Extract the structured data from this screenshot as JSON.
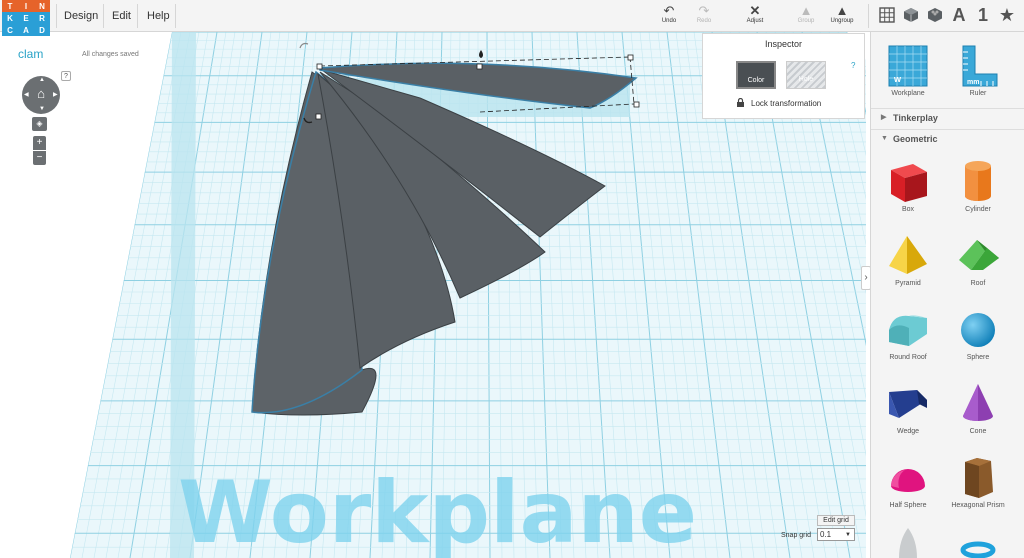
{
  "logo": {
    "letters": [
      "T",
      "I",
      "N",
      "K",
      "E",
      "R",
      "C",
      "A",
      "D"
    ],
    "colors": [
      "#e6632a",
      "#e6632a",
      "#e6632a",
      "#2a9fd6",
      "#2a9fd6",
      "#2a9fd6",
      "#2a9fd6",
      "#2a9fd6",
      "#2a9fd6"
    ]
  },
  "menu": {
    "items": [
      "Design",
      "Edit",
      "Help"
    ]
  },
  "toolbar": {
    "undo": {
      "label": "Undo",
      "icon": "undo-icon"
    },
    "redo": {
      "label": "Redo",
      "icon": "redo-icon"
    },
    "adjust": {
      "label": "Adjust",
      "icon": "adjust-icon"
    },
    "group": {
      "label": "Group",
      "icon": "group-icon"
    },
    "ungroup": {
      "label": "Ungroup",
      "icon": "ungroup-icon"
    }
  },
  "view_buttons": [
    "grid-icon",
    "cube-icon",
    "brick-icon",
    "letter-a-icon",
    "number-1-icon",
    "star-icon"
  ],
  "view_labels": {
    "a": "A",
    "one": "1"
  },
  "project": {
    "name": "clam",
    "status": "All changes saved",
    "help": "?"
  },
  "inspector": {
    "title": "Inspector",
    "color_label": "Color",
    "hole_label": "Hole",
    "help": "?",
    "lock_label": "Lock transformation"
  },
  "workplane_text": "Workplane",
  "grid": {
    "edit_label": "Edit grid",
    "snap_label": "Snap grid",
    "snap_value": "0.1"
  },
  "sidebar": {
    "workplane": "Workplane",
    "ruler": "Ruler",
    "sections": [
      "Tinkerplay",
      "Geometric"
    ],
    "shapes": [
      {
        "name": "Box",
        "color": "#d81f26"
      },
      {
        "name": "Cylinder",
        "color": "#e8781c"
      },
      {
        "name": "Pyramid",
        "color": "#f2c318"
      },
      {
        "name": "Roof",
        "color": "#3ba639"
      },
      {
        "name": "Round Roof",
        "color": "#6ccbd3"
      },
      {
        "name": "Sphere",
        "color": "#1fa2dc"
      },
      {
        "name": "Wedge",
        "color": "#243e8f"
      },
      {
        "name": "Cone",
        "color": "#8d3fb1"
      },
      {
        "name": "Half Sphere",
        "color": "#e0147f"
      },
      {
        "name": "Hexagonal Prism",
        "color": "#8a5a2b"
      }
    ]
  },
  "colors": {
    "accent": "#2aa3c7",
    "shape_fill": "#5a6065",
    "grid_blue": "#b5e4ee",
    "workplane_text": "#7fd3ee"
  }
}
